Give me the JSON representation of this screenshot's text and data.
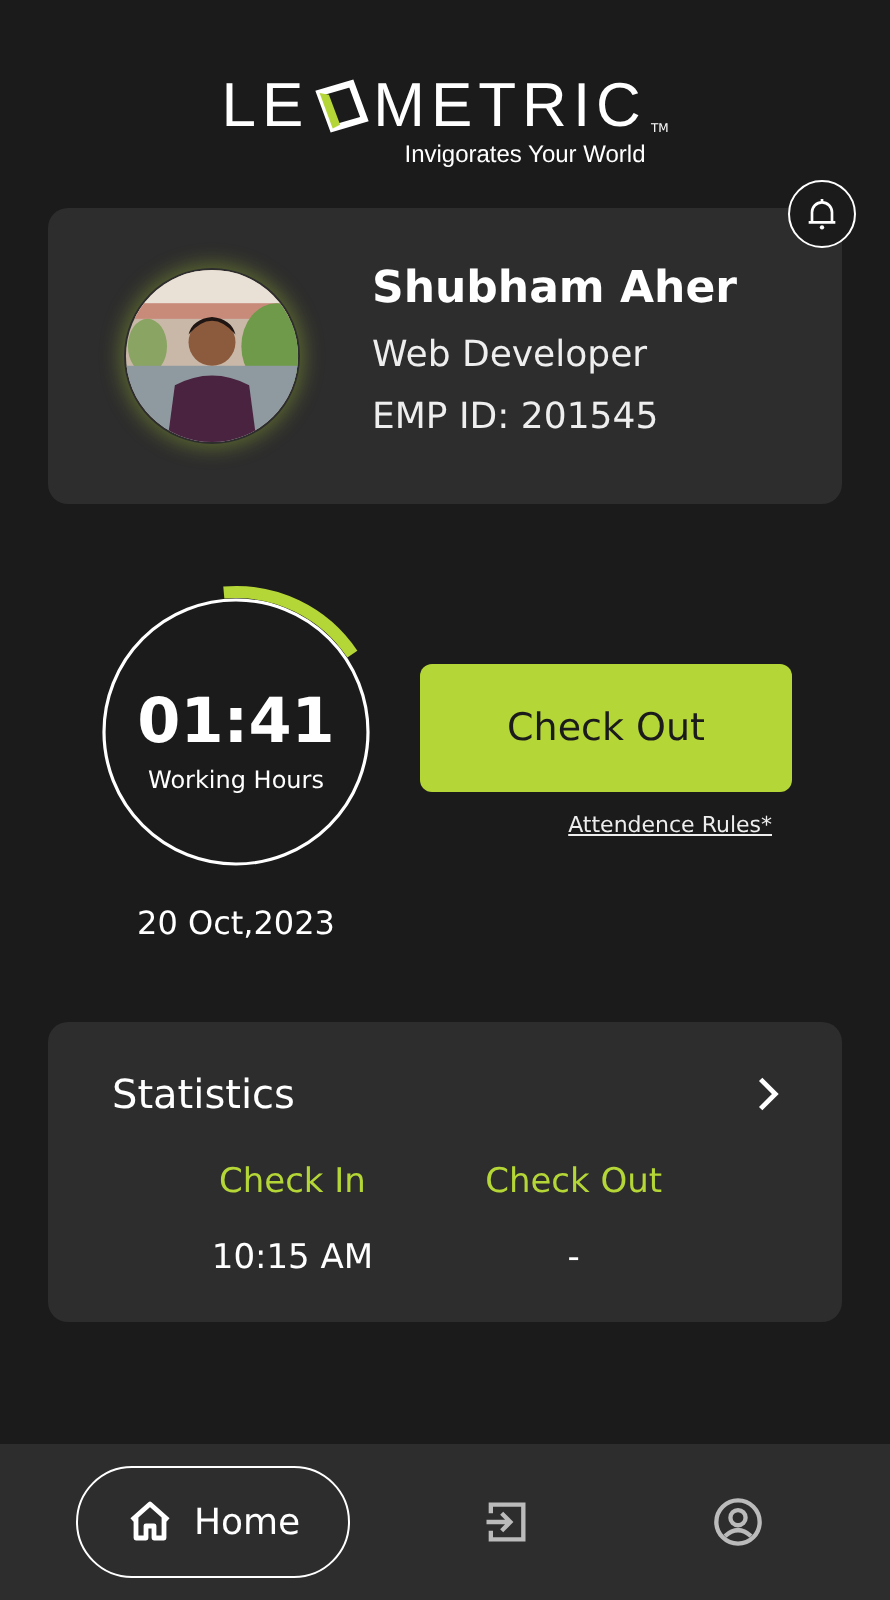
{
  "logo": {
    "left": "LE",
    "right": "METRIC",
    "trademark": "TM",
    "tagline": "Invigorates Your World"
  },
  "profile": {
    "name": "Shubham Aher",
    "role": "Web Developer",
    "emp_id": "EMP ID: 201545"
  },
  "timer": {
    "time": "01:41",
    "caption": "Working Hours",
    "level": 0.17,
    "date": "20 Oct,2023"
  },
  "check_button": "Check Out",
  "rules_link": "Attendence Rules*",
  "statistics": {
    "title": "Statistics",
    "columns": [
      {
        "heading": "Check In",
        "value": "10:15 AM"
      },
      {
        "heading": "Check Out",
        "value": "-"
      }
    ]
  },
  "nav": [
    {
      "kind": "home",
      "label": "Home",
      "selected": true
    },
    {
      "kind": "logout",
      "selected": false
    },
    {
      "kind": "profile",
      "selected": false
    }
  ]
}
